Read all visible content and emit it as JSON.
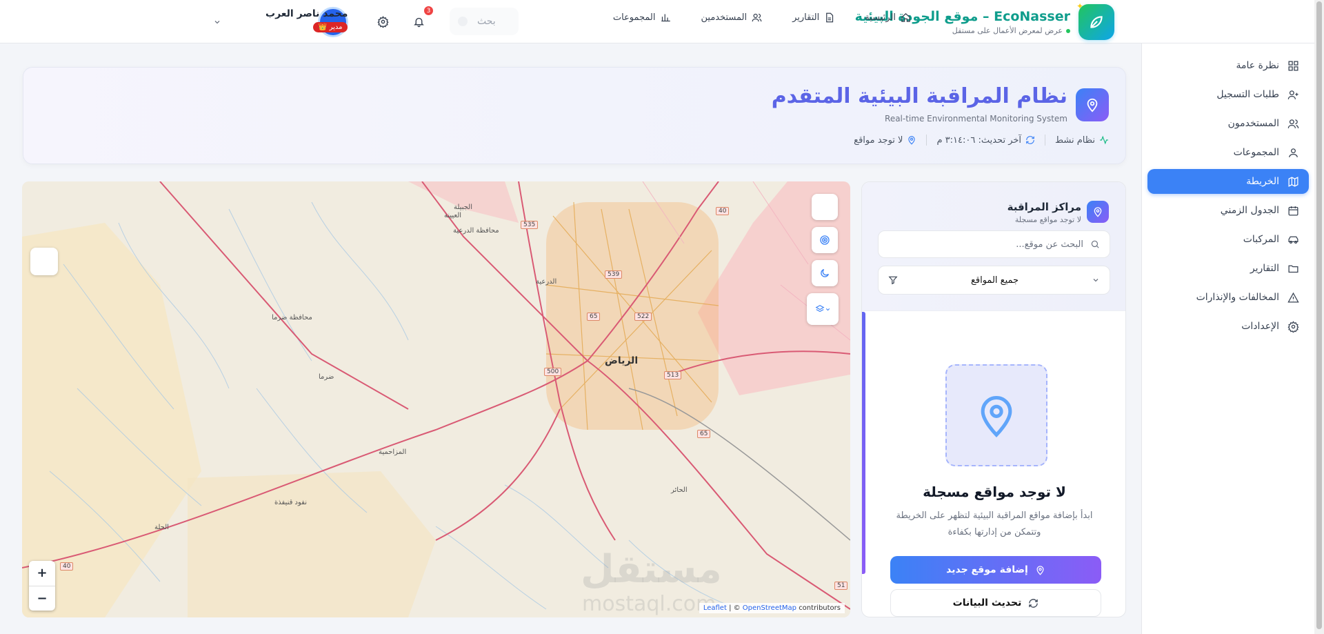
{
  "brand": {
    "title": "EcoNasser – موقع الجودة البيئية",
    "subtitle": "عرض لمعرض الأعمال على مستقل"
  },
  "nav": [
    {
      "label": "الرئيسية",
      "icon": "home-icon"
    },
    {
      "label": "التقارير",
      "icon": "document-icon"
    },
    {
      "label": "المستخدمين",
      "icon": "users-icon"
    },
    {
      "label": "المجموعات",
      "icon": "bar-chart-icon"
    }
  ],
  "search": {
    "placeholder": "بحث"
  },
  "notifications": {
    "count": "3"
  },
  "user": {
    "name": "محمد ناصر العرب",
    "initial": "م",
    "role": "👑 مدير"
  },
  "sidebar": {
    "items": [
      {
        "label": "نظرة عامة",
        "icon": "grid-icon"
      },
      {
        "label": "طلبات التسجيل",
        "icon": "user-plus-icon"
      },
      {
        "label": "المستخدمون",
        "icon": "users-icon"
      },
      {
        "label": "المجموعات",
        "icon": "user-group-icon"
      },
      {
        "label": "الخريطة",
        "icon": "map-icon",
        "active": true
      },
      {
        "label": "الجدول الزمني",
        "icon": "calendar-icon"
      },
      {
        "label": "المركبات",
        "icon": "car-icon"
      },
      {
        "label": "التقارير",
        "icon": "folder-icon"
      },
      {
        "label": "المخالفات والإنذارات",
        "icon": "warning-icon"
      },
      {
        "label": "الإعدادات",
        "icon": "gear-icon"
      }
    ]
  },
  "header": {
    "title": "نظام المراقبة البيئية المتقدم",
    "subtitle": "Real-time Environmental Monitoring System",
    "status": "نظام نشط",
    "last_update": "آخر تحديث: ٣:١٤:٠٦ م",
    "sites": "لا توجد مواقع"
  },
  "map": {
    "city_label": "الرياض",
    "labels": [
      "الجبيلة",
      "العيينة",
      "محافظة الدرعية",
      "الدرعية",
      "محافظة ضرما",
      "ضرما",
      "المزاحمية",
      "نفود قنيفذة",
      "الحلة",
      "الحائر"
    ],
    "roads": [
      "535",
      "539",
      "65",
      "522",
      "500",
      "513",
      "65",
      "40",
      "40",
      "51"
    ],
    "zoom_in": "+",
    "zoom_out": "−",
    "attribution_leaflet": "Leaflet",
    "attribution_osm": "OpenStreetMap",
    "attribution_rest": "contributors",
    "watermark": "مستقل",
    "watermark_url": "mostaql.com"
  },
  "panel": {
    "title": "مراكز المراقبة",
    "subtitle": "لا توجد مواقع مسجلة",
    "search_placeholder": "البحث عن موقع...",
    "filter_value": "جميع المواقع",
    "empty_title": "لا توجد مواقع مسجلة",
    "empty_desc": "ابدأ بإضافة مواقع المراقبة البيئية لتظهر على الخريطة وتتمكن من إدارتها بكفاءة",
    "add_button": "إضافة موقع جديد",
    "refresh_button": "تحديث البيانات"
  },
  "colors": {
    "accent": "#3b82f6",
    "accent2": "#8b5cf6",
    "brand": "#0f9d8c",
    "danger": "#dc2626"
  }
}
